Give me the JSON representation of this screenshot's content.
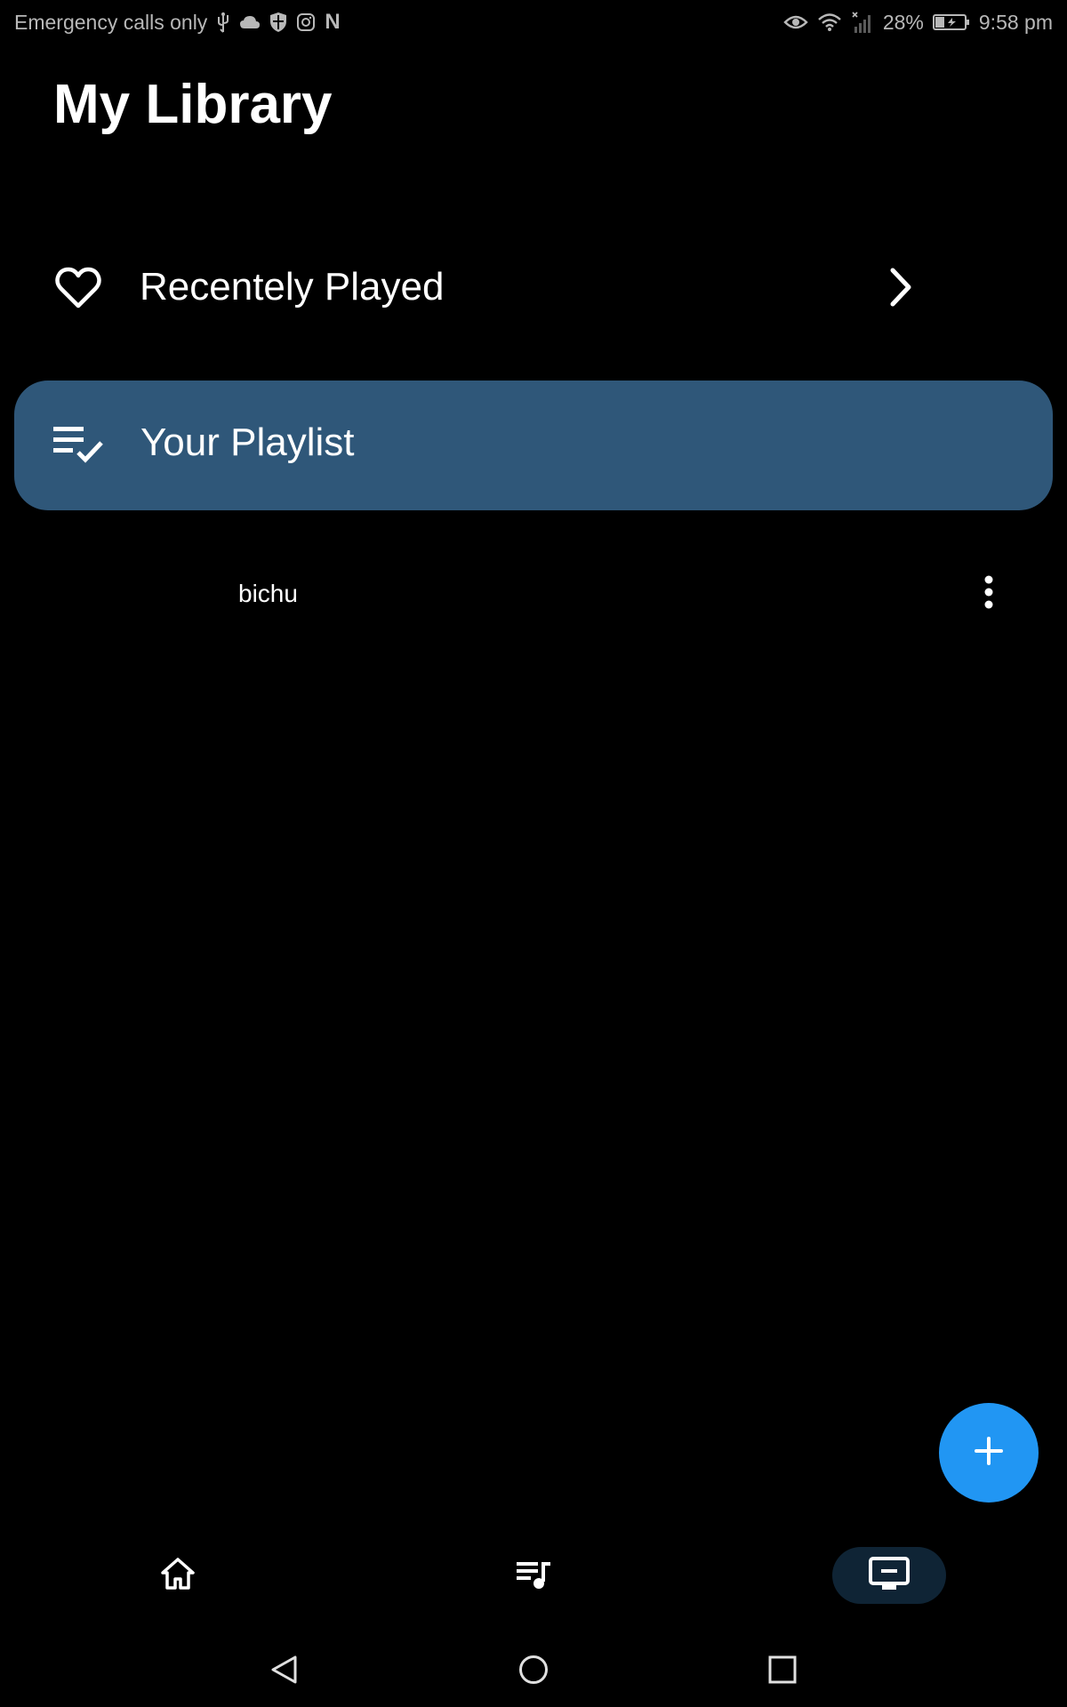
{
  "status_bar": {
    "left_text": "Emergency calls only",
    "battery": "28%",
    "time": "9:58 pm",
    "icons_left": [
      "usb-icon",
      "cloud-icon",
      "shield-icon",
      "instagram-icon",
      "netflix-icon"
    ],
    "icons_right": [
      "eye-icon",
      "wifi-icon",
      "signal-icon",
      "battery-icon"
    ],
    "netflix_glyph": "N"
  },
  "header": {
    "title": "My Library"
  },
  "library": {
    "recent": {
      "label": "Recentely Played",
      "icon": "heart-icon",
      "trailing_icon": "chevron-right-icon"
    },
    "playlist": {
      "label": "Your Playlist",
      "icon": "playlist-check-icon",
      "highlight_color": "#2f5779"
    },
    "items": [
      {
        "label": "bichu",
        "trailing_icon": "more-vert-icon"
      }
    ]
  },
  "fab": {
    "icon": "plus-icon",
    "color": "#2196f3"
  },
  "bottom_nav": {
    "items": [
      {
        "id": "home",
        "icon": "home-icon",
        "selected": false
      },
      {
        "id": "playlists",
        "icon": "queue-music-icon",
        "selected": false
      },
      {
        "id": "library",
        "icon": "monitor-icon",
        "selected": true
      }
    ],
    "selected_background": "#0f2435"
  },
  "system_nav": {
    "buttons": [
      "back-icon",
      "home-circle-icon",
      "recents-icon"
    ]
  }
}
